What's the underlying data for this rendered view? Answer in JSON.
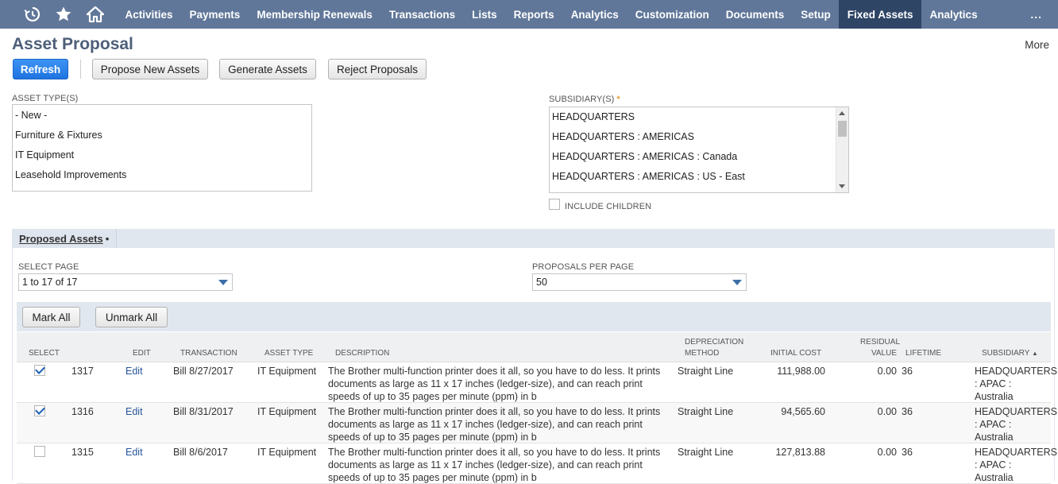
{
  "nav": {
    "icons": [
      "recent-icon",
      "star-icon",
      "home-icon"
    ],
    "items": [
      "Activities",
      "Payments",
      "Membership Renewals",
      "Transactions",
      "Lists",
      "Reports",
      "Analytics",
      "Customization",
      "Documents",
      "Setup",
      "Fixed Assets",
      "Analytics"
    ],
    "active_index": 10,
    "more": "..."
  },
  "header": {
    "title": "Asset Proposal",
    "more": "More"
  },
  "buttons": {
    "refresh": "Refresh",
    "propose": "Propose New Assets",
    "generate": "Generate Assets",
    "reject": "Reject Proposals"
  },
  "asset_types": {
    "label": "ASSET TYPE(S)",
    "options": [
      "- New -",
      "Furniture & Fixtures",
      "IT Equipment",
      "Leasehold Improvements"
    ]
  },
  "subsidiaries": {
    "label": "SUBSIDIARY(S)",
    "required_mark": "*",
    "options": [
      "HEADQUARTERS",
      "HEADQUARTERS : AMERICAS",
      "HEADQUARTERS : AMERICAS : Canada",
      "HEADQUARTERS : AMERICAS : US - East"
    ],
    "include_children_label": "INCLUDE CHILDREN",
    "include_children_checked": false
  },
  "subtab": {
    "label": "Proposed Assets",
    "marker": "•"
  },
  "paging": {
    "select_page_label": "SELECT PAGE",
    "select_page_value": "1 to 17 of 17",
    "per_page_label": "PROPOSALS PER PAGE",
    "per_page_value": "50"
  },
  "list_buttons": {
    "mark_all": "Mark All",
    "unmark_all": "Unmark All"
  },
  "table": {
    "columns": {
      "select": "SELECT",
      "edit": "EDIT",
      "transaction": "TRANSACTION",
      "asset_type": "ASSET TYPE",
      "description": "DESCRIPTION",
      "depreciation_1": "DEPRECIATION",
      "depreciation_2": "METHOD",
      "initial_cost": "INITIAL COST",
      "residual_1": "RESIDUAL",
      "residual_2": "VALUE",
      "lifetime": "LIFETIME",
      "subsidiary": "SUBSIDIARY",
      "sort_indicator": "▲"
    },
    "rows": [
      {
        "checked": true,
        "id": "1317",
        "edit": "Edit",
        "transaction": "Bill 8/27/2017",
        "asset_type": "IT Equipment",
        "description": "The Brother multi-function printer does it all, so you have to do less. It prints documents as large as 11 x 17 inches (ledger-size), and can reach print speeds of up to 35 pages per minute (ppm) in b",
        "depreciation": "Straight Line",
        "initial_cost": "111,988.00",
        "residual": "0.00",
        "lifetime": "36",
        "subsidiary": "HEADQUARTERS : APAC : Australia"
      },
      {
        "checked": true,
        "id": "1316",
        "edit": "Edit",
        "transaction": "Bill 8/31/2017",
        "asset_type": "IT Equipment",
        "description": "The Brother multi-function printer does it all, so you have to do less. It prints documents as large as 11 x 17 inches (ledger-size), and can reach print speeds of up to 35 pages per minute (ppm) in b",
        "depreciation": "Straight Line",
        "initial_cost": "94,565.60",
        "residual": "0.00",
        "lifetime": "36",
        "subsidiary": "HEADQUARTERS : APAC : Australia"
      },
      {
        "checked": false,
        "id": "1315",
        "edit": "Edit",
        "transaction": "Bill 8/6/2017",
        "asset_type": "IT Equipment",
        "description": "The Brother multi-function printer does it all, so you have to do less. It prints documents as large as 11 x 17 inches (ledger-size), and can reach print speeds of up to 35 pages per minute (ppm) in b",
        "depreciation": "Straight Line",
        "initial_cost": "127,813.88",
        "residual": "0.00",
        "lifetime": "36",
        "subsidiary": "HEADQUARTERS : APAC : Australia"
      }
    ]
  }
}
